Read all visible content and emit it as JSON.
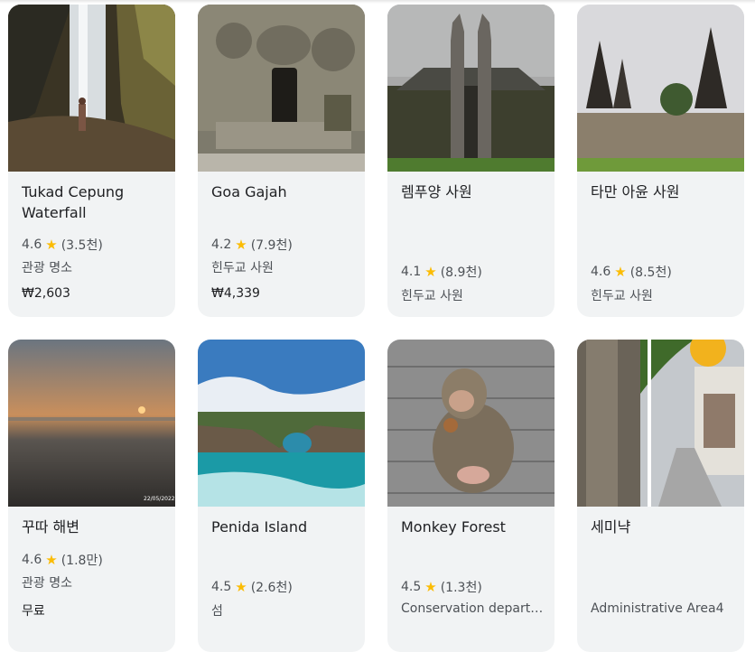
{
  "cards": [
    {
      "title": "Tukad Cepung Waterfall",
      "rating": "4.6",
      "star_icon": "star-icon",
      "reviews": "(3.5천)",
      "category": "관광 명소",
      "price": "₩2,603"
    },
    {
      "title": "Goa Gajah",
      "rating": "4.2",
      "star_icon": "star-icon",
      "reviews": "(7.9천)",
      "category": "힌두교 사원",
      "price": "₩4,339"
    },
    {
      "title": "렘푸양 사원",
      "rating": "4.1",
      "star_icon": "star-icon",
      "reviews": "(8.9천)",
      "category": "힌두교 사원"
    },
    {
      "title": "타만 아윤 사원",
      "rating": "4.6",
      "star_icon": "star-icon",
      "reviews": "(8.5천)",
      "category": "힌두교 사원"
    },
    {
      "title": "꾸따 해변",
      "rating": "4.6",
      "star_icon": "star-icon",
      "reviews": "(1.8만)",
      "category": "관광 명소",
      "price": "무료",
      "photo_stamp": "22/05/2022"
    },
    {
      "title": "Penida Island",
      "rating": "4.5",
      "star_icon": "star-icon",
      "reviews": "(2.6천)",
      "category": "섬"
    },
    {
      "title": "Monkey Forest",
      "rating": "4.5",
      "star_icon": "star-icon",
      "reviews": "(1.3천)",
      "category": "Conservation department"
    },
    {
      "title": "세미냑",
      "category": "Administrative Area4"
    }
  ],
  "colors": {
    "star": "#fbbc04",
    "card_bg": "#f1f3f4",
    "text": "#202124",
    "muted": "#4d5156"
  }
}
